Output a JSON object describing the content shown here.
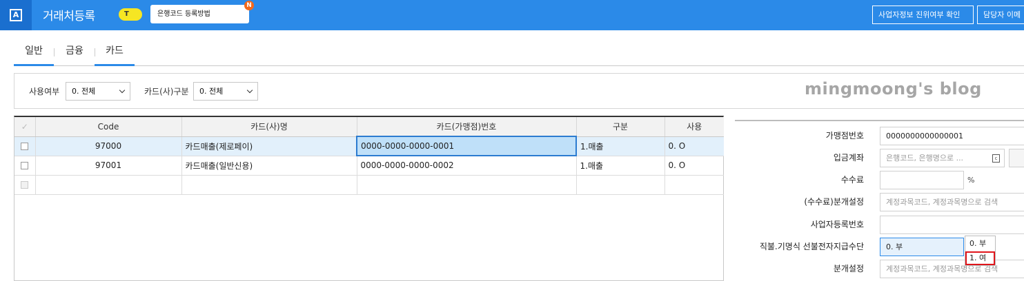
{
  "header": {
    "logo_icon": "A",
    "title": "거래처등록",
    "tip_pill": "T",
    "tip_text": "은행코드 등록방법",
    "tip_badge": "N",
    "btn_verify": "사업자정보 진위여부 확인",
    "btn_manager": "담당자 이메"
  },
  "tabs": [
    {
      "label": "일반",
      "active": true
    },
    {
      "label": "금융",
      "active": false
    },
    {
      "label": "카드",
      "active": true
    }
  ],
  "filters": {
    "use_label": "사용여부",
    "use_value": "0. 전체",
    "card_type_label": "카드(사)구분",
    "card_type_value": "0. 전체"
  },
  "watermark": "mingmoong's blog",
  "grid": {
    "columns": [
      "✓",
      "Code",
      "카드(사)명",
      "카드(가맹점)번호",
      "구분",
      "사용"
    ],
    "rows": [
      {
        "code": "97000",
        "name": "카드매출(제로페이)",
        "number": "0000-0000-0000-0001",
        "type": "1.매출",
        "use": "0. O"
      },
      {
        "code": "97001",
        "name": "카드매출(일반신용)",
        "number": "0000-0000-0000-0002",
        "type": "1.매출",
        "use": "0. O"
      }
    ]
  },
  "form": {
    "merchant_no_label": "가맹점번호",
    "merchant_no_value": "0000000000000001",
    "deposit_label": "입금계좌",
    "deposit_placeholder": "은행코드, 은행명으로 ...",
    "fee_label": "수수료",
    "fee_unit": "%",
    "fee_split_label": "(수수료)분개설정",
    "fee_split_placeholder": "계정과목코드, 계정과목명으로 검색",
    "bizno_label": "사업자등록번호",
    "prepaid_label": "직불.기명식 선불전자지급수단",
    "prepaid_value": "0. 부",
    "split_label": "분개설정",
    "split_placeholder": "계정과목코드, 계정과목명으로 검색"
  },
  "dropdown": {
    "options": [
      "0.  부",
      "1.  여"
    ],
    "highlighted_index": 1
  },
  "colors": {
    "header_bg": "#2b8ae8",
    "logo_bg": "#1a6fcf",
    "highlight_red": "#e0151b"
  }
}
